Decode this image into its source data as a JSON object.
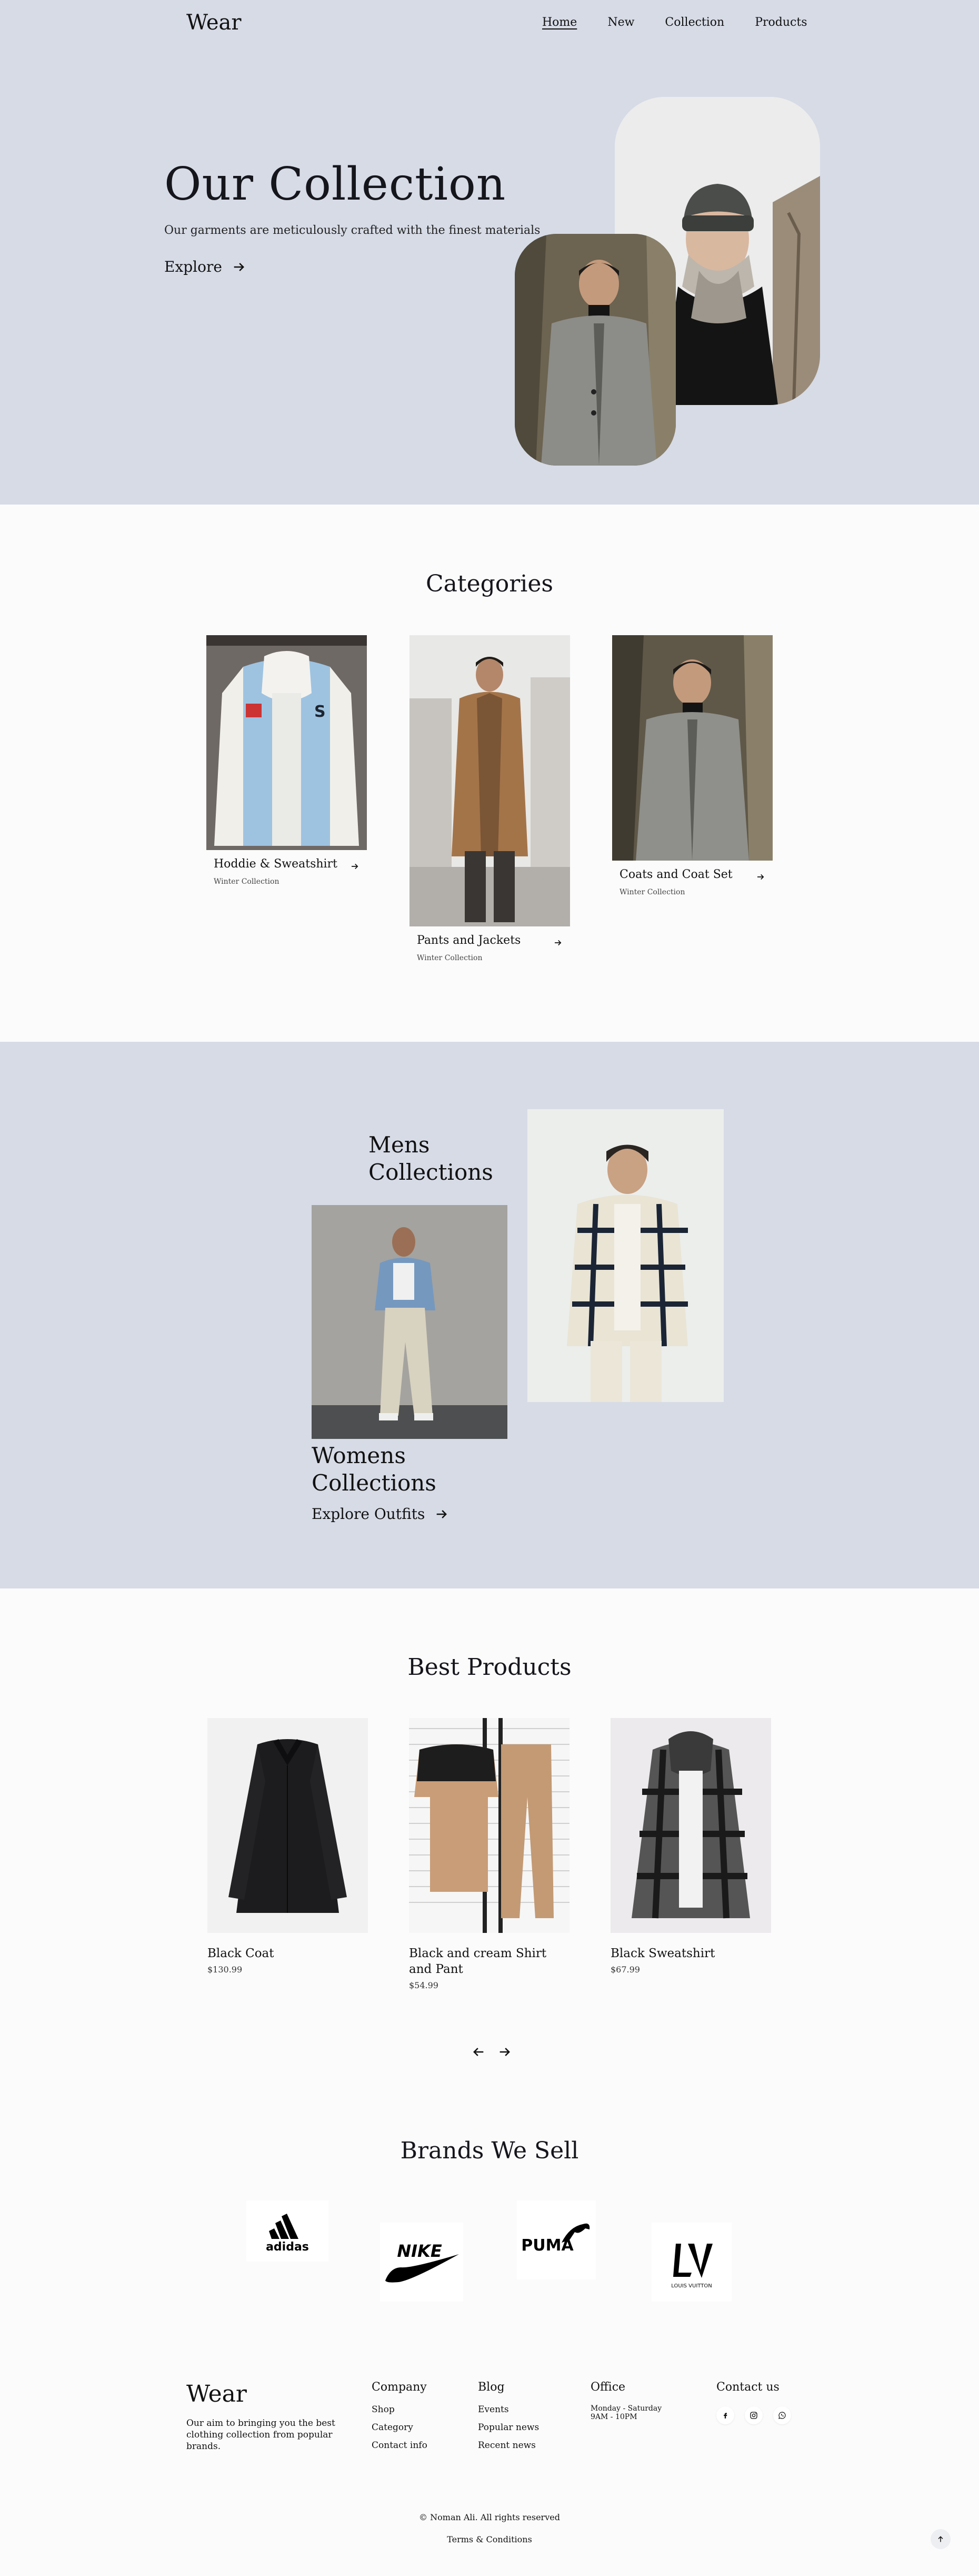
{
  "header": {
    "logo": "Wear",
    "nav": [
      "Home",
      "New",
      "Collection",
      "Products"
    ]
  },
  "hero": {
    "title": "Our Collection",
    "subtitle": "Our garments are meticulously crafted with the finest materials",
    "cta": "Explore"
  },
  "categories": {
    "title": "Categories",
    "items": [
      {
        "name": "Hoddie & Sweatshirt",
        "sub": "Winter Collection"
      },
      {
        "name": "Pants and Jackets",
        "sub": "Winter Collection"
      },
      {
        "name": "Coats and Coat Set",
        "sub": "Winter Collection"
      }
    ]
  },
  "collections": {
    "mens_title_1": "Mens",
    "mens_title_2": "Collections",
    "womens_title_1": "Womens",
    "womens_title_2": "Collections",
    "cta": "Explore Outfits"
  },
  "products": {
    "title": "Best Products",
    "items": [
      {
        "name": "Black Coat",
        "price": "$130.99"
      },
      {
        "name": "Black and cream Shirt and Pant",
        "price": "$54.99"
      },
      {
        "name": "Black Sweatshirt",
        "price": "$67.99"
      }
    ]
  },
  "brands": {
    "title": "Brands We Sell",
    "items": [
      "adidas",
      "NIKE",
      "PUMA",
      "LOUIS VUITTON"
    ]
  },
  "footer": {
    "logo": "Wear",
    "aim": "Our aim to bringing you the best clothing collection from popular brands.",
    "company_title": "Company",
    "company_links": [
      "Shop",
      "Category",
      "Contact info"
    ],
    "blog_title": "Blog",
    "blog_links": [
      "Events",
      "Popular news",
      "Recent news"
    ],
    "office_title": "Office",
    "office_days": "Monday - Saturday",
    "office_hours": "9AM - 10PM",
    "contact_title": "Contact us",
    "copyright": "© Noman Ali. All rights reserved",
    "terms": "Terms & Conditions"
  },
  "colors": {
    "hero_bg": "#d6dbe6",
    "page_bg": "#fbfbfb",
    "text": "#15151c"
  }
}
